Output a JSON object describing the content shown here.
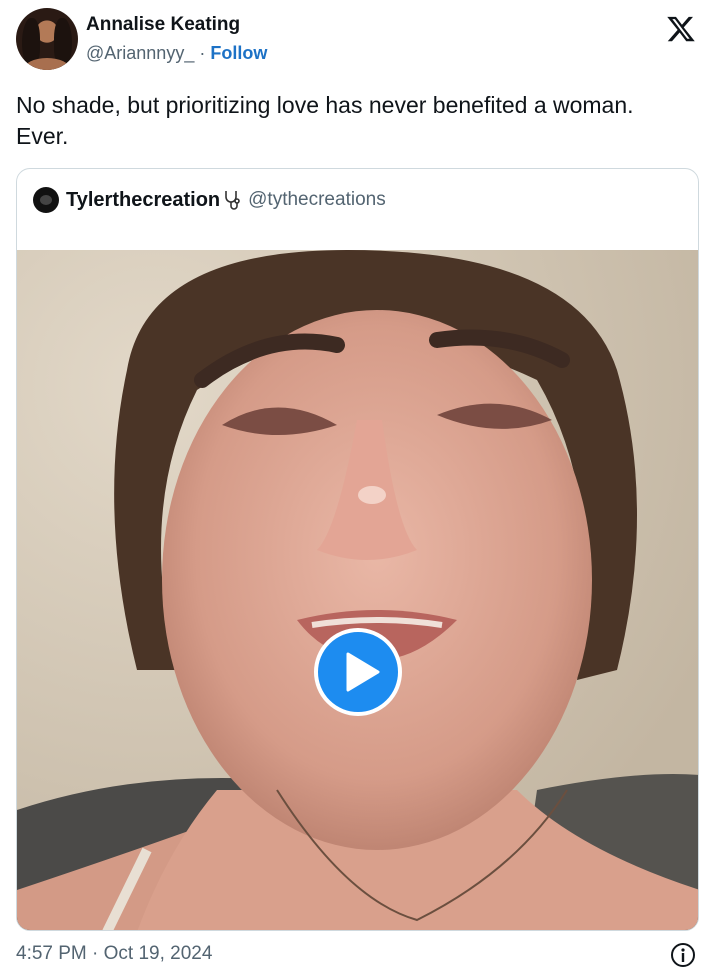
{
  "tweet": {
    "author_name": "Annalise Keating",
    "handle": "@Ariannnyy_",
    "separator": "·",
    "follow_label": "Follow",
    "text": "No shade, but prioritizing love has never benefited a woman. Ever.",
    "timestamp": "4:57 PM · Oct 19, 2024"
  },
  "quote": {
    "author_name": "Tylerthecreation",
    "handle": "@tythecreations",
    "emoji_icon": "stethoscope-icon"
  },
  "icons": {
    "brand": "x-logo-icon",
    "play": "play-icon",
    "info": "info-icon"
  },
  "colors": {
    "text": "#0f1419",
    "secondary": "#536471",
    "link": "#1d72c6",
    "play_button": "#1d8cf0",
    "border": "#cfd9de"
  }
}
